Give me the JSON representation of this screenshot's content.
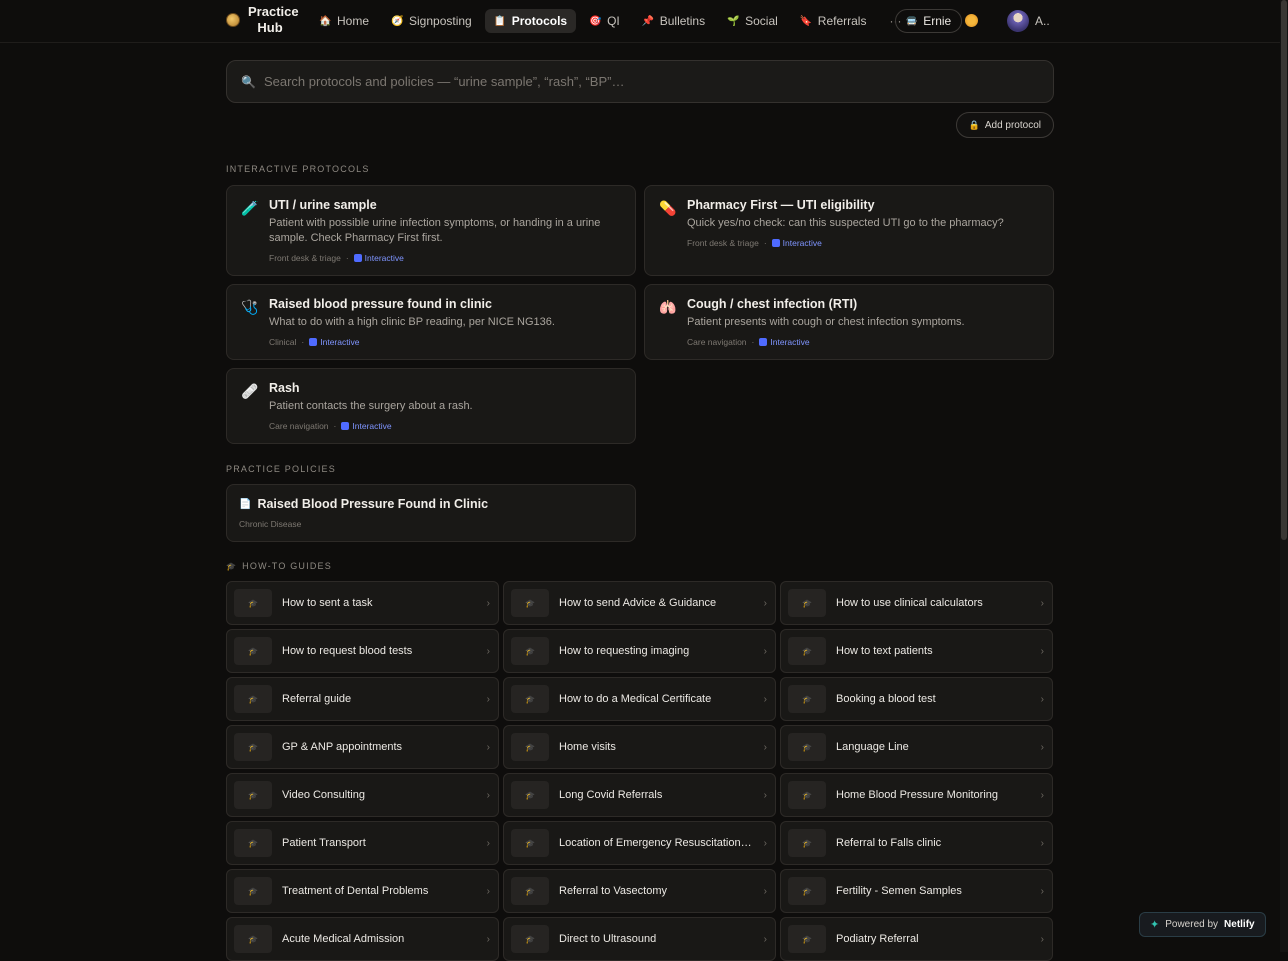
{
  "app": {
    "title": "Practice Hub"
  },
  "nav": {
    "items": [
      {
        "label": "Home",
        "icon": "house-icon",
        "glyph": "🏠"
      },
      {
        "label": "Signposting",
        "icon": "compass-icon",
        "glyph": "🧭"
      },
      {
        "label": "Protocols",
        "icon": "clipboard-icon",
        "glyph": "📋",
        "active": true
      },
      {
        "label": "QI",
        "icon": "target-icon",
        "glyph": "🎯"
      },
      {
        "label": "Bulletins",
        "icon": "pin-icon",
        "glyph": "📌"
      },
      {
        "label": "Social",
        "icon": "sprout-icon",
        "glyph": "🌱"
      },
      {
        "label": "Referrals",
        "icon": "bookmark-icon",
        "glyph": "🔖"
      }
    ],
    "more": "···",
    "user": "Ernie",
    "user_icon": "🚍",
    "avatar_label": "A.."
  },
  "search": {
    "placeholder": "Search protocols and policies — “urine sample”, “rash”, “BP”…"
  },
  "add_protocol": {
    "label": "Add protocol"
  },
  "interactive": {
    "heading": "INTERACTIVE PROTOCOLS",
    "cards": [
      {
        "glyph": "🧪",
        "title": "UTI / urine sample",
        "desc": "Patient with possible urine infection symptoms, or handing in a urine sample. Check Pharmacy First first.",
        "category": "Front desk & triage",
        "badge": "Interactive"
      },
      {
        "glyph": "💊",
        "title": "Pharmacy First — UTI eligibility",
        "desc": "Quick yes/no check: can this suspected UTI go to the pharmacy?",
        "category": "Front desk & triage",
        "badge": "Interactive"
      },
      {
        "glyph": "🩺",
        "title": "Raised blood pressure found in clinic",
        "desc": "What to do with a high clinic BP reading, per NICE NG136.",
        "category": "Clinical",
        "badge": "Interactive"
      },
      {
        "glyph": "🫁",
        "title": "Cough / chest infection (RTI)",
        "desc": "Patient presents with cough or chest infection symptoms.",
        "category": "Care navigation",
        "badge": "Interactive"
      },
      {
        "glyph": "🩹",
        "title": "Rash",
        "desc": "Patient contacts the surgery about a rash.",
        "category": "Care navigation",
        "badge": "Interactive"
      }
    ]
  },
  "policies": {
    "heading": "PRACTICE POLICIES",
    "items": [
      {
        "title": "Raised Blood Pressure Found in Clinic",
        "category": "Chronic Disease"
      }
    ]
  },
  "guides": {
    "heading": "HOW-TO GUIDES",
    "items": [
      "How to sent a task",
      "How to send Advice & Guidance",
      "How to use clinical calculators",
      "How to request blood tests",
      "How to requesting imaging",
      "How to text patients",
      "Referral guide",
      "How to do a Medical Certificate",
      "Booking a blood test",
      "GP & ANP appointments",
      "Home visits",
      "Language Line",
      "Video Consulting",
      "Long Covid Referrals",
      "Home Blood Pressure Monitoring",
      "Patient Transport",
      "Location of Emergency Resuscitation…",
      "Referral to Falls clinic",
      "Treatment of Dental Problems",
      "Referral to Vasectomy",
      "Fertility - Semen Samples",
      "Acute Medical Admission",
      "Direct to Ultrasound",
      "Podiatry Referral"
    ]
  },
  "footer": {
    "powered_by": "Powered by",
    "brand": "Netlify"
  }
}
